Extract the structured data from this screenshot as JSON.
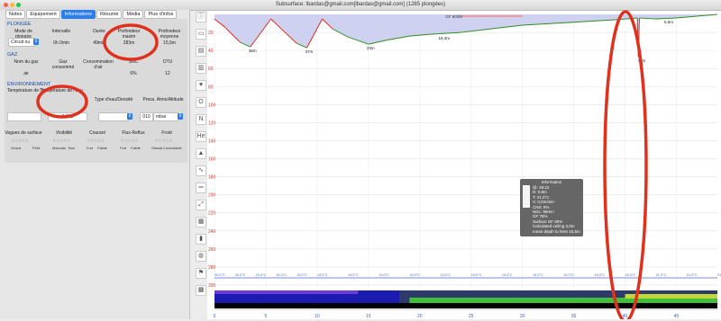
{
  "window": {
    "title": "Subsurface: lbardas@gmail.com[lbardas@gmail.com] (1285 plongées)"
  },
  "tabs": [
    {
      "label": "Notes"
    },
    {
      "label": "Equipement"
    },
    {
      "label": "Informations",
      "active": true
    },
    {
      "label": "Résumé"
    },
    {
      "label": "Média"
    },
    {
      "label": "Plus d'infos"
    }
  ],
  "info": {
    "plongee": {
      "heading": "PLONGÉE",
      "mode_label": "Mode de plongée",
      "mode_value": "Circuit ou",
      "interval_label": "Intervalle",
      "interval_value": "0h 0min",
      "duration_label": "Durée",
      "duration_value": "49min",
      "maxdepth_label": "Profondeur maxim",
      "maxdepth_value": "283m",
      "meandepth_label": "Profondeur moyenne",
      "meandepth_value": "15,5m"
    },
    "gaz": {
      "heading": "GAZ",
      "name_label": "Nom du gaz",
      "name_value": "air",
      "consumption_label": "Gaz consommé",
      "consumption_value": "",
      "sac_label": "Consommation d'air",
      "sac_value": "",
      "snc_label": "SNC",
      "snc_value": "6%",
      "otu_label": "OTU",
      "otu_value": "12"
    },
    "environnement": {
      "heading": "ENVIRONNEMENT",
      "airtemp_label": "Température de l'air",
      "watertemp_label": "Température de l'eau",
      "watertemp_value": "0,0°C",
      "water_type_label": "Type d'eau/Densité",
      "pressure_label": "Press. Atmo/Altitude",
      "pressure_value": "010",
      "pressure_unit": "mbar"
    },
    "conditions": {
      "waves_label": "Vagues de surface",
      "waves_low": "Grand",
      "waves_high": "Petit",
      "visibility_label": "Visibilité",
      "visibility_low": "Mauvais",
      "visibility_high": "Bon",
      "current_label": "Courant",
      "current_low": "Fort",
      "current_high": "Faible",
      "surge_label": "Flux-Reflux",
      "surge_low": "Fort",
      "surge_high": "Faible",
      "chill_label": "Froid",
      "chill_low": "Glacial",
      "chill_high": "Confortable",
      "star_glyphs": "☆☆☆☆☆"
    }
  },
  "toolbar_icons": [
    {
      "name": "info-icon",
      "glyph": "ⓘ"
    },
    {
      "name": "ceiling-icon",
      "glyph": "▭"
    },
    {
      "name": "calc-ceiling-icon",
      "glyph": "▤"
    },
    {
      "name": "tissue-icon",
      "glyph": "▥"
    },
    {
      "name": "heart-rate-icon",
      "glyph": "♥"
    },
    {
      "name": "po2-icon",
      "glyph": "O"
    },
    {
      "name": "pn2-icon",
      "glyph": "N"
    },
    {
      "name": "phe-icon",
      "glyph": "He"
    },
    {
      "name": "gradient-icon",
      "glyph": "▲"
    },
    {
      "name": "profile-icon",
      "glyph": "∿"
    },
    {
      "name": "ruler-icon",
      "glyph": "═"
    },
    {
      "name": "scale-icon",
      "glyph": "⤢"
    },
    {
      "name": "pictures-icon",
      "glyph": "▦"
    },
    {
      "name": "tank-icon",
      "glyph": "▮"
    },
    {
      "name": "sac-icon",
      "glyph": "◍"
    },
    {
      "name": "deco-icon",
      "glyph": "⚑"
    },
    {
      "name": "heatmap-icon",
      "glyph": "▩"
    }
  ],
  "chart_data": {
    "type": "line",
    "ylabel": "",
    "xlabel": "",
    "x_ticks": [
      0,
      5,
      10,
      15,
      20,
      25,
      30,
      35,
      40,
      45
    ],
    "y_ticks": [
      20,
      40,
      60,
      80,
      100,
      120,
      140,
      160,
      180,
      200,
      220,
      240,
      260,
      280,
      300
    ],
    "xlim": [
      0,
      49
    ],
    "ylim": [
      0,
      305
    ],
    "y_inverted": true,
    "depth_profile": {
      "x": [
        0,
        1,
        2.5,
        3.5,
        5.5,
        6.5,
        8,
        9,
        10.5,
        11.5,
        13,
        15,
        17,
        19,
        21,
        24,
        27,
        30,
        33,
        36,
        39,
        41.2,
        41.3,
        41.4,
        43,
        45,
        47,
        49
      ],
      "y": [
        5,
        14,
        31,
        36,
        5,
        16,
        32,
        37,
        5,
        16,
        25,
        33,
        28,
        24,
        22,
        20,
        16,
        12,
        10,
        8,
        6,
        4,
        47,
        4,
        5,
        4,
        2,
        0
      ]
    },
    "labels": [
      {
        "text": "36m",
        "x": 3.5,
        "y": 36
      },
      {
        "text": "37m",
        "x": 9,
        "y": 37
      },
      {
        "text": "33m",
        "x": 15,
        "y": 33
      },
      {
        "text": "18,4m",
        "x": 22,
        "y": 22
      },
      {
        "text": "5,5m",
        "x": 44,
        "y": 4
      },
      {
        "text": "47m",
        "x": 41.4,
        "y": 47
      },
      {
        "text": "GF 80/80",
        "x": 22.5,
        "y": 0
      }
    ],
    "temperature": {
      "x": [
        0,
        2,
        4,
        6,
        8,
        10,
        13,
        16,
        19,
        22,
        25,
        28,
        31,
        34,
        37,
        40,
        43,
        46,
        49
      ],
      "labels": [
        "20,0°C",
        "20,0°C",
        "19,0°C",
        "19,0°C",
        "19,0°C",
        "19,0°C",
        "19,0°C",
        "19,0°C",
        "19,0°C",
        "19,0°C",
        "19,0°C",
        "19,0°C",
        "19,0°C",
        "19,0°C",
        "19,0°C",
        "19,0°C",
        "21,0°C",
        "21,0°C",
        "21,0°C"
      ]
    }
  },
  "tooltip": {
    "title": "Information",
    "lines": [
      "@: 49:22",
      "D: 0,8m",
      "T: 21,0°C",
      "V: 0,0m/min",
      "CNS: 6%",
      "NDL: 99min",
      "GF 78%",
      "Surface GF 90%",
      "Calculated ceiling 3,0m",
      "mean depth to here 15,5m"
    ]
  },
  "colors": {
    "accent": "#2b7df0",
    "annotation": "#e0301e",
    "profile_fill": "#c7c9ee",
    "temperature": "#4a67c9"
  }
}
